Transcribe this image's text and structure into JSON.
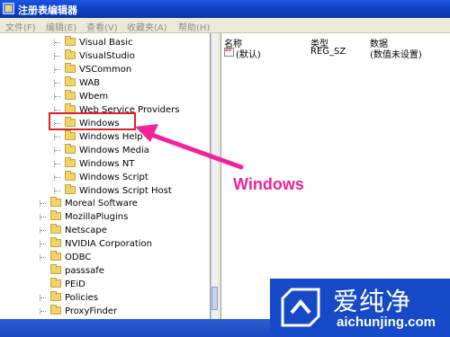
{
  "window": {
    "title": "注册表编辑器"
  },
  "menu": [
    "文件(F)",
    "编辑(E)",
    "查看(V)",
    "收藏夹(A)",
    "帮助(H)"
  ],
  "tree": {
    "items": [
      {
        "label": "Visual Basic"
      },
      {
        "label": "VisualStudio"
      },
      {
        "label": "VSCommon"
      },
      {
        "label": "WAB"
      },
      {
        "label": "Wbem"
      },
      {
        "label": "Web Service Providers"
      },
      {
        "label": "Windows",
        "highlighted": true
      },
      {
        "label": "Windows Help"
      },
      {
        "label": "Windows Media"
      },
      {
        "label": "Windows NT"
      },
      {
        "label": "Windows Script"
      },
      {
        "label": "Windows Script Host"
      },
      {
        "label": "Moreal Software"
      },
      {
        "label": "MozillaPlugins"
      },
      {
        "label": "Netscape"
      },
      {
        "label": "NVIDIA Corporation"
      },
      {
        "label": "ODBC"
      },
      {
        "label": "passsafe"
      },
      {
        "label": "PEiD"
      },
      {
        "label": "Policies"
      },
      {
        "label": "ProxyFinder"
      }
    ]
  },
  "list": {
    "columns": [
      "名称",
      "类型",
      "数据"
    ],
    "rows": [
      {
        "name": "(默认)",
        "type": "REG_SZ",
        "data": "(数值未设置)"
      }
    ]
  },
  "annotation": {
    "text": "Windows",
    "color": "#f2229a"
  },
  "watermark": {
    "brand": "爱纯净",
    "url": "aichunjing.com"
  },
  "colors": {
    "highlight_box": "#e02020",
    "titlebar": "#0c3fc0"
  }
}
